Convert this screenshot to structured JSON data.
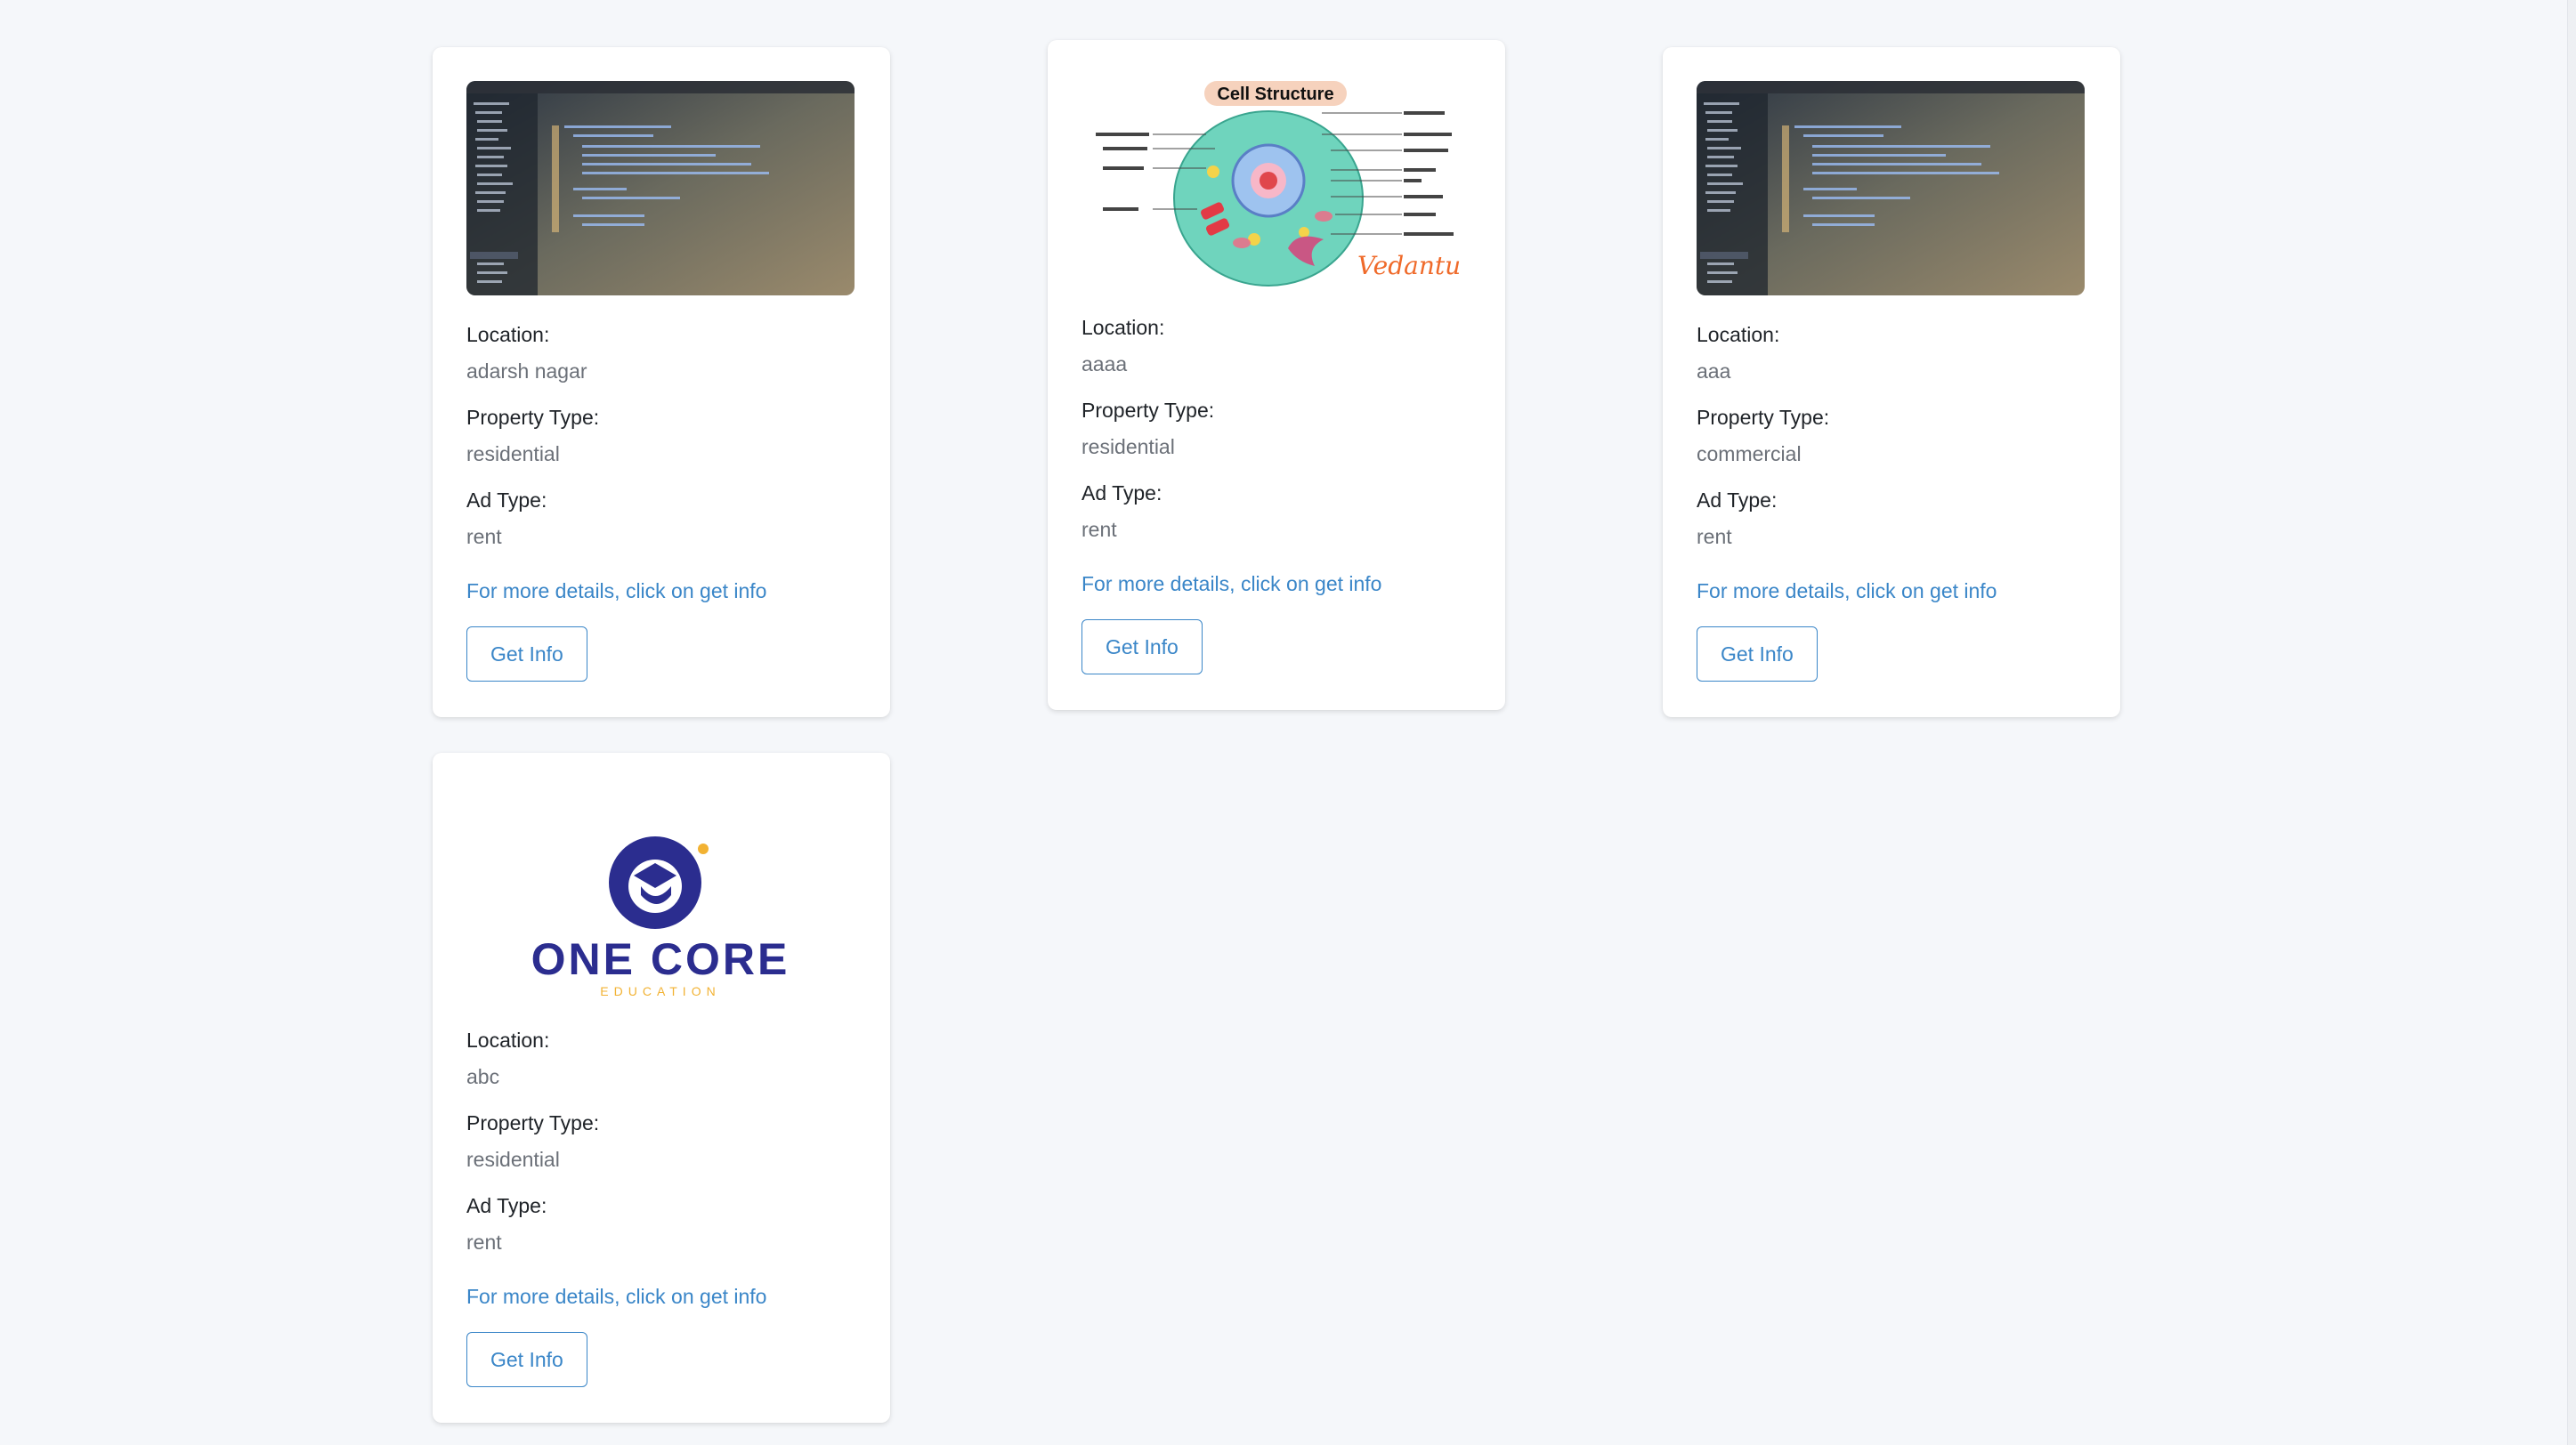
{
  "cards": [
    {
      "image": "code-editor-screenshot",
      "location_label": "Location:",
      "location": "adarsh nagar",
      "property_type_label": "Property Type:",
      "property_type": "residential",
      "ad_type_label": "Ad Type:",
      "ad_type": "rent",
      "details_text": "For more details, click on get info",
      "button_label": "Get Info"
    },
    {
      "image": "cell-structure-diagram",
      "image_title": "Cell Structure",
      "image_brand": "Vedantu",
      "location_label": "Location:",
      "location": "aaaa",
      "property_type_label": "Property Type:",
      "property_type": "residential",
      "ad_type_label": "Ad Type:",
      "ad_type": "rent",
      "details_text": "For more details, click on get info",
      "button_label": "Get Info"
    },
    {
      "image": "code-editor-screenshot",
      "location_label": "Location:",
      "location": "aaa",
      "property_type_label": "Property Type:",
      "property_type": "commercial",
      "ad_type_label": "Ad Type:",
      "ad_type": "rent",
      "details_text": "For more details, click on get info",
      "button_label": "Get Info"
    },
    {
      "image": "one-core-logo",
      "image_title": "ONE CORE",
      "image_subtitle": "EDUCATION",
      "location_label": "Location:",
      "location": "abc",
      "property_type_label": "Property Type:",
      "property_type": "residential",
      "ad_type_label": "Ad Type:",
      "ad_type": "rent",
      "details_text": "For more details, click on get info",
      "button_label": "Get Info"
    }
  ],
  "colors": {
    "background": "#f5f7fa",
    "link": "#3a86c8",
    "label": "#1f2328",
    "value": "#6b7078"
  }
}
